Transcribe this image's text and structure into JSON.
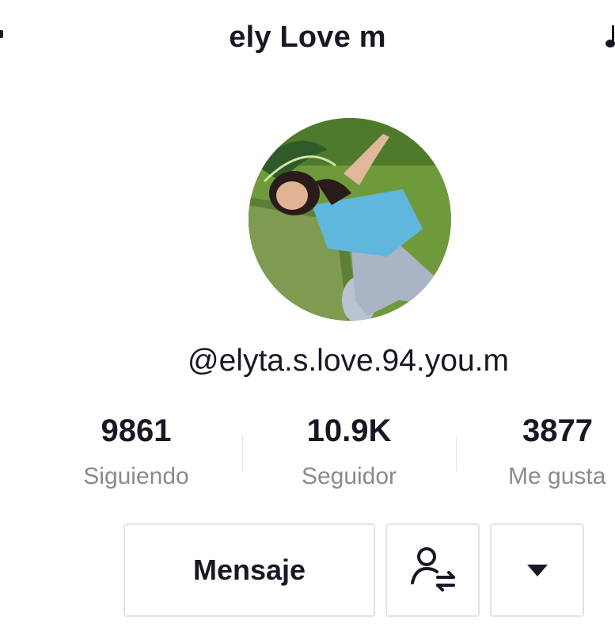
{
  "header": {
    "title": "ely Love m"
  },
  "profile": {
    "handle": "@elyta.s.love.94.you.m"
  },
  "stats": [
    {
      "value": "9861",
      "label": "Siguiendo"
    },
    {
      "value": "10.9K",
      "label": "Seguidor"
    },
    {
      "value": "3877",
      "label": "Me gusta"
    }
  ],
  "actions": {
    "message_label": "Mensaje",
    "friends_icon": "user-swap-icon",
    "more_icon": "caret-down-icon"
  },
  "colors": {
    "text_primary": "#161823",
    "text_secondary": "#8a8b91",
    "border": "#e3e3e4"
  }
}
